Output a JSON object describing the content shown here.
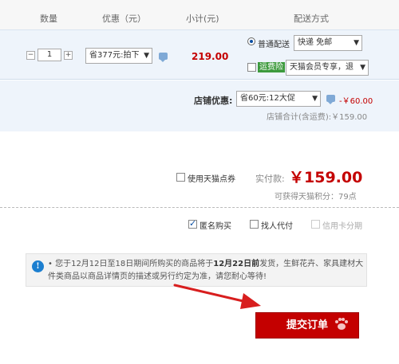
{
  "columns": {
    "quantity": "数量",
    "discount": "优惠（元）",
    "subtotal": "小计(元)",
    "delivery": "配送方式"
  },
  "item": {
    "quantity_minus": "−",
    "quantity_value": "1",
    "quantity_plus": "+",
    "promo_select": "省377元:拍下",
    "subtotal": "219.00",
    "delivery_option": "普通配送",
    "delivery_select": "快递 免邮",
    "insurance_label": "运费险",
    "insurance_select": "天猫会员专享，退"
  },
  "shop": {
    "discount_label": "店铺优惠:",
    "discount_select": "省60元:12大促",
    "discount_amount": "-￥60.00",
    "total_label": "店铺合计(含运费):￥159.00"
  },
  "payment": {
    "points_label": "使用天猫点券",
    "actual_label": "实付款:",
    "actual_amount": "￥159.00",
    "earn_points": "可获得天猫积分：79点"
  },
  "options": {
    "anonymous": "匿名购买",
    "proxy_pay": "找人代付",
    "credit_installment": "信用卡分期"
  },
  "notice": {
    "prefix": "• 您于12月12日至18日期间所购买的商品将于",
    "bold": "12月22日前",
    "suffix": "发货，生鲜花卉、家具建材大件类商品以商品详情页的描述或另行约定为准，请您耐心等待!"
  },
  "submit_button": "提交订单",
  "colors": {
    "accent_red": "#c40000",
    "row_bg": "#eef4fb",
    "info_blue": "#1c7fd0"
  }
}
